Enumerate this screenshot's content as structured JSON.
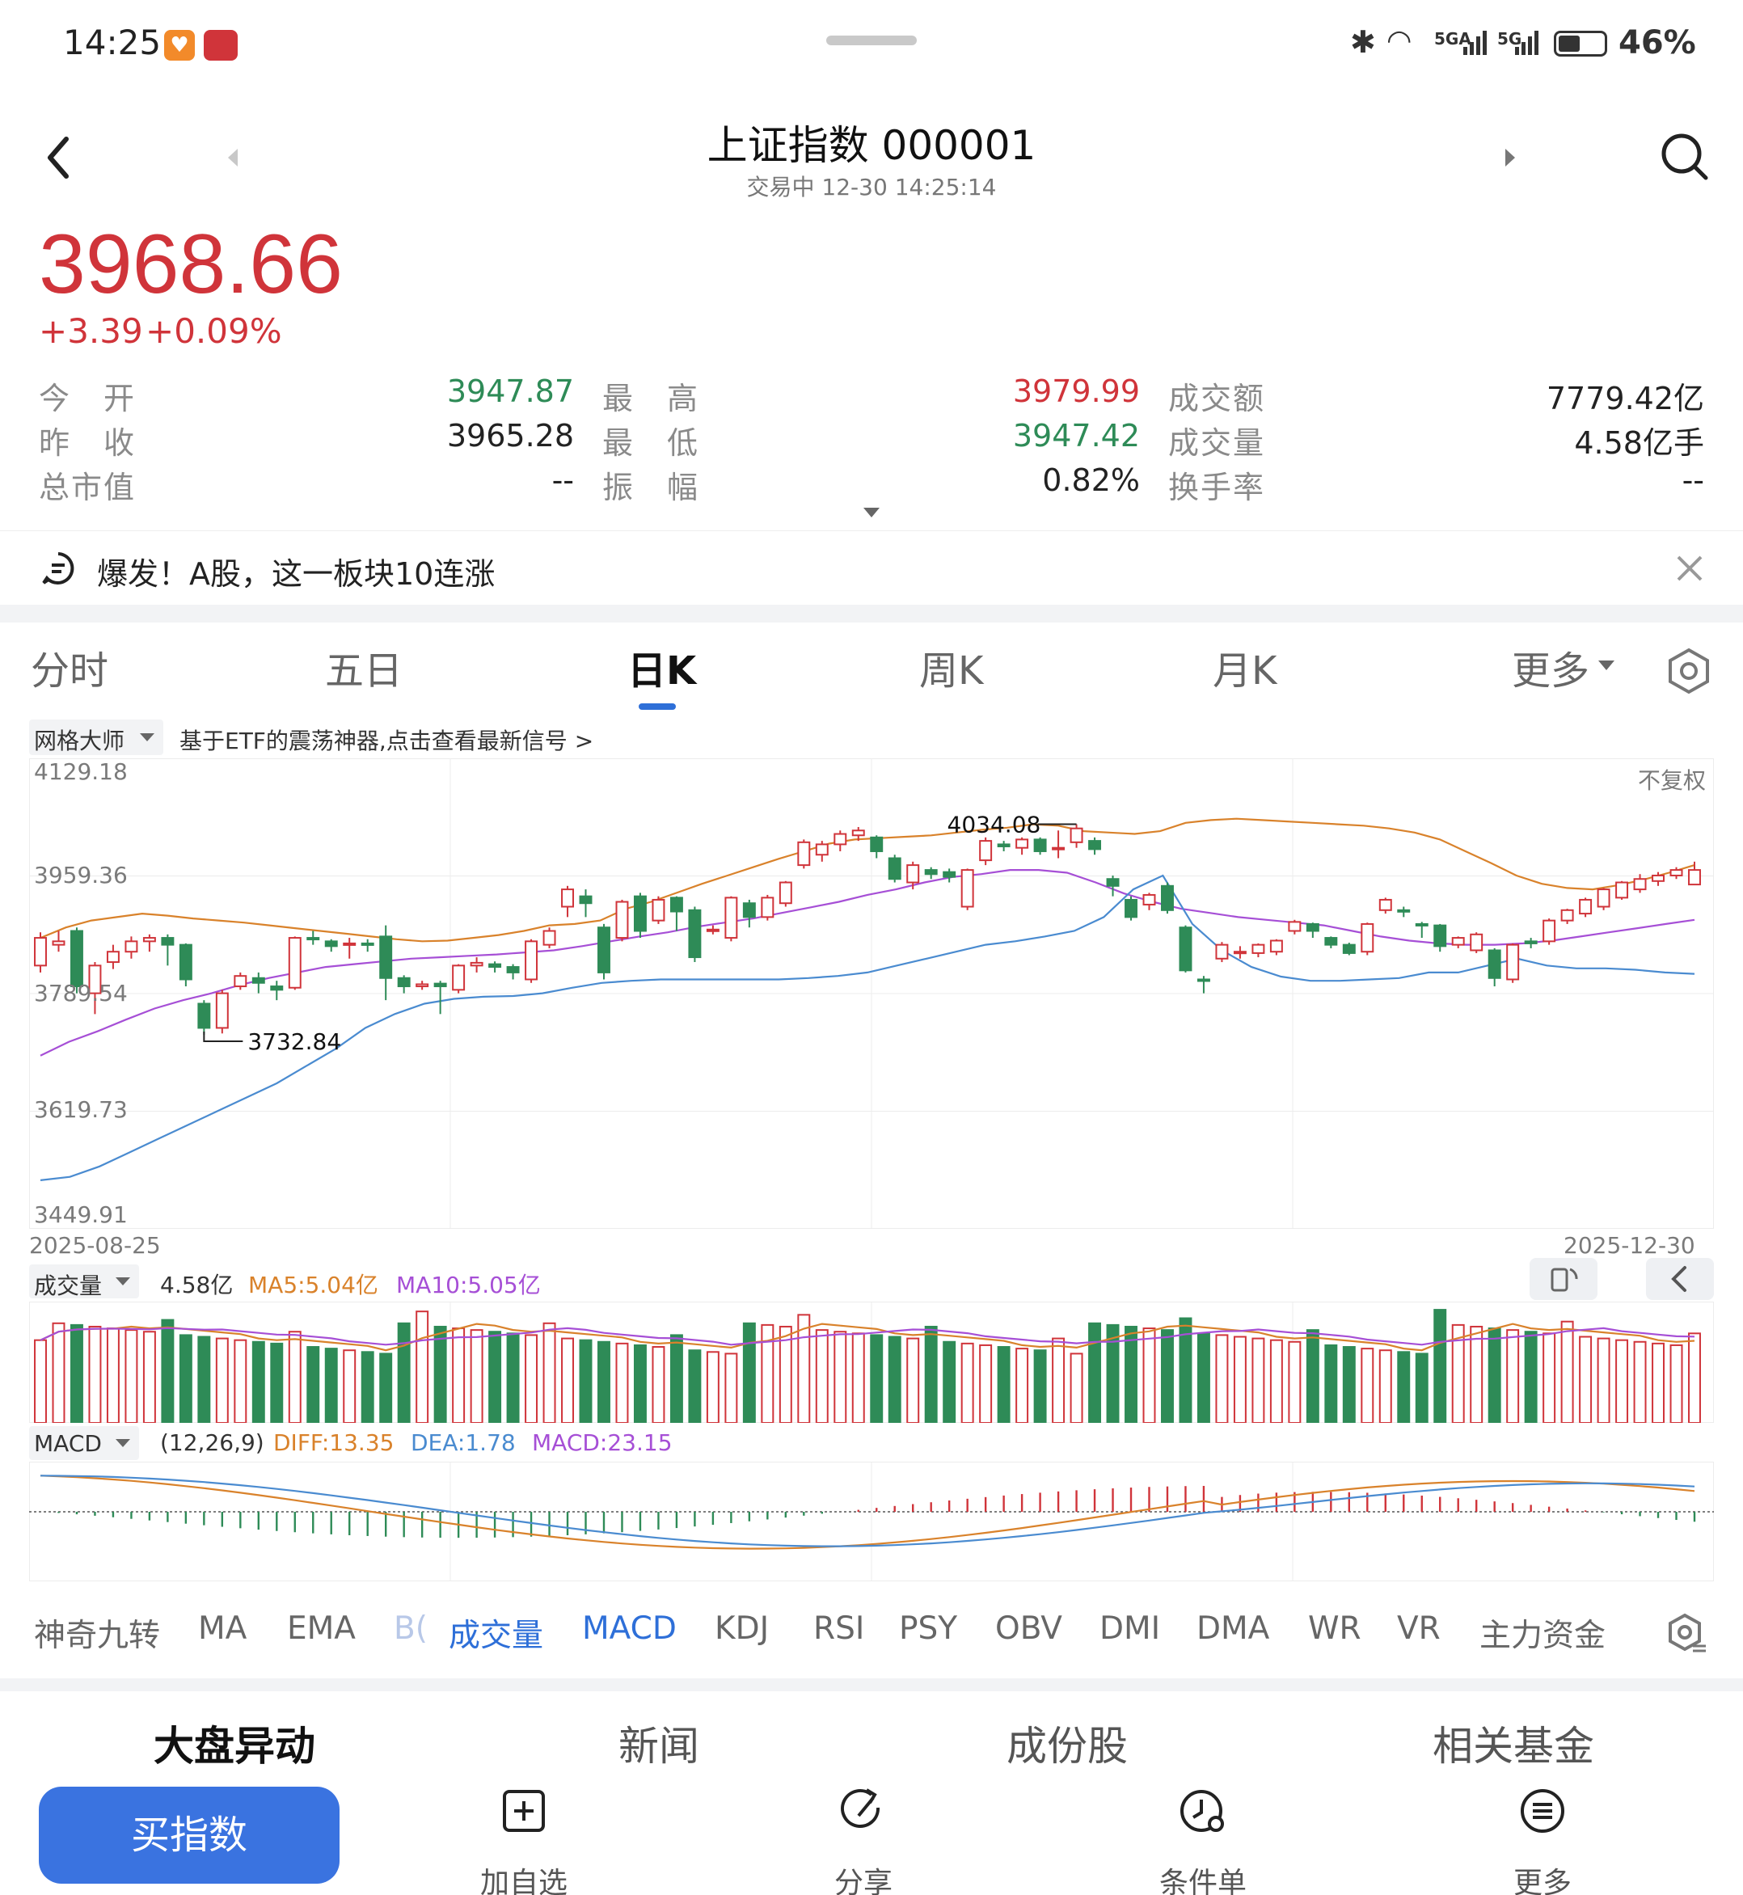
{
  "status_bar": {
    "time": "14:25",
    "battery": "46%",
    "network_1": "5GA",
    "network_2": "5G"
  },
  "header": {
    "title": "上证指数 000001",
    "subtitle": "交易中 12-30 14:25:14"
  },
  "quote": {
    "price": "3968.66",
    "change": "+3.39",
    "change_pct": "+0.09%",
    "stats": [
      {
        "label": "今　开",
        "value": "3947.87",
        "color": "green"
      },
      {
        "label": "最　高",
        "value": "3979.99",
        "color": "red"
      },
      {
        "label": "成交额",
        "value": "7779.42亿",
        "color": "black"
      },
      {
        "label": "昨　收",
        "value": "3965.28",
        "color": "black"
      },
      {
        "label": "最　低",
        "value": "3947.42",
        "color": "green"
      },
      {
        "label": "成交量",
        "value": "4.58亿手",
        "color": "black"
      },
      {
        "label": "总市值",
        "value": "--",
        "color": "black"
      },
      {
        "label": "振　幅",
        "value": "0.82%",
        "color": "black"
      },
      {
        "label": "换手率",
        "value": "--",
        "color": "black"
      }
    ]
  },
  "news_banner": {
    "text": "爆发！A股，这一板块10连涨"
  },
  "period_tabs": [
    "分时",
    "五日",
    "日K",
    "周K",
    "月K",
    "更多"
  ],
  "active_period": "日K",
  "grid_tool": {
    "name": "网格大师",
    "promo": "基于ETF的震荡神器,点击查看最新信号 >"
  },
  "chart_labels": {
    "adjust": "不复权",
    "date_start": "2025-08-25",
    "date_end": "2025-12-30",
    "high_mark": "4034.08",
    "low_mark": "3732.84"
  },
  "volume_header": {
    "name": "成交量",
    "value": "4.58亿",
    "ma5": "MA5:5.04亿",
    "ma10": "MA10:5.05亿"
  },
  "macd_header": {
    "name": "MACD",
    "params": "(12,26,9)",
    "diff": "DIFF:13.35",
    "dea": "DEA:1.78",
    "macd": "MACD:23.15"
  },
  "indicator_tabs": [
    "神奇九转",
    "MA",
    "EMA",
    "B(",
    "成交量",
    "MACD",
    "KDJ",
    "RSI",
    "PSY",
    "OBV",
    "DMI",
    "DMA",
    "WR",
    "VR",
    "主力资金"
  ],
  "bottom_tabs": [
    "大盘异动",
    "新闻",
    "成份股",
    "相关基金"
  ],
  "actions": {
    "buy": "买指数",
    "add": "加自选",
    "share": "分享",
    "condition": "条件单",
    "more": "更多"
  },
  "colors": {
    "up": "#d0343a",
    "down": "#2e8b57",
    "accent": "#2e6fd8",
    "boll_upper": "#d9822b",
    "boll_mid": "#a64fd6",
    "boll_lower": "#4a8bd0"
  },
  "chart_data": {
    "type": "candlestick",
    "y_ticks": [
      "4129.18",
      "3959.36",
      "3789.54",
      "3619.73",
      "3449.91"
    ],
    "ylim": [
      3449.91,
      4129.18
    ],
    "x_range": [
      "2025-08-25",
      "2025-12-30"
    ],
    "candles": [
      [
        3830,
        3870,
        3820,
        3878
      ],
      [
        3860,
        3865,
        3850,
        3880
      ],
      [
        3880,
        3800,
        3790,
        3885
      ],
      [
        3790,
        3830,
        3760,
        3835
      ],
      [
        3835,
        3850,
        3825,
        3860
      ],
      [
        3850,
        3865,
        3840,
        3872
      ],
      [
        3865,
        3870,
        3850,
        3875
      ],
      [
        3870,
        3860,
        3830,
        3875
      ],
      [
        3860,
        3810,
        3800,
        3862
      ],
      [
        3775,
        3740,
        3730,
        3780
      ],
      [
        3740,
        3790,
        3732,
        3795
      ],
      [
        3800,
        3815,
        3795,
        3820
      ],
      [
        3812,
        3805,
        3790,
        3820
      ],
      [
        3800,
        3795,
        3780,
        3808
      ],
      [
        3798,
        3870,
        3795,
        3872
      ],
      [
        3870,
        3868,
        3860,
        3880
      ],
      [
        3865,
        3858,
        3850,
        3868
      ],
      [
        3860,
        3862,
        3840,
        3870
      ],
      [
        3862,
        3860,
        3850,
        3868
      ],
      [
        3872,
        3812,
        3780,
        3888
      ],
      [
        3812,
        3800,
        3790,
        3816
      ],
      [
        3800,
        3803,
        3795,
        3808
      ],
      [
        3804,
        3800,
        3760,
        3808
      ],
      [
        3795,
        3830,
        3790,
        3832
      ],
      [
        3830,
        3834,
        3820,
        3842
      ],
      [
        3832,
        3828,
        3820,
        3836
      ],
      [
        3828,
        3820,
        3810,
        3832
      ],
      [
        3810,
        3865,
        3805,
        3868
      ],
      [
        3860,
        3880,
        3855,
        3885
      ],
      [
        3915,
        3940,
        3900,
        3945
      ],
      [
        3930,
        3920,
        3900,
        3940
      ],
      [
        3885,
        3820,
        3810,
        3890
      ],
      [
        3870,
        3922,
        3865,
        3925
      ],
      [
        3930,
        3880,
        3870,
        3935
      ],
      [
        3895,
        3925,
        3890,
        3930
      ],
      [
        3928,
        3908,
        3880,
        3930
      ],
      [
        3910,
        3842,
        3835,
        3915
      ],
      [
        3880,
        3882,
        3875,
        3888
      ],
      [
        3870,
        3928,
        3865,
        3930
      ],
      [
        3920,
        3900,
        3885,
        3925
      ],
      [
        3900,
        3928,
        3895,
        3932
      ],
      [
        3920,
        3950,
        3915,
        3952
      ],
      [
        3975,
        4008,
        3970,
        4012
      ],
      [
        3990,
        4005,
        3980,
        4010
      ],
      [
        4005,
        4020,
        3995,
        4025
      ],
      [
        4018,
        4025,
        4010,
        4030
      ],
      [
        4015,
        3995,
        3985,
        4018
      ],
      [
        3985,
        3955,
        3950,
        3990
      ],
      [
        3950,
        3975,
        3940,
        3980
      ],
      [
        3968,
        3962,
        3955,
        3972
      ],
      [
        3965,
        3958,
        3950,
        3970
      ],
      [
        3915,
        3968,
        3910,
        3970
      ],
      [
        3982,
        4010,
        3975,
        4015
      ],
      [
        4005,
        4002,
        3995,
        4010
      ],
      [
        4000,
        4012,
        3990,
        4015
      ],
      [
        4012,
        3995,
        3990,
        4015
      ],
      [
        3998,
        4000,
        3985,
        4025
      ],
      [
        4008,
        4028,
        4000,
        4034
      ],
      [
        4010,
        3998,
        3990,
        4015
      ],
      [
        3955,
        3945,
        3930,
        3960
      ],
      [
        3925,
        3900,
        3895,
        3930
      ],
      [
        3918,
        3932,
        3910,
        3935
      ],
      [
        3945,
        3910,
        3905,
        3950
      ],
      [
        3885,
        3823,
        3820,
        3888
      ],
      [
        3810,
        3808,
        3790,
        3815
      ],
      [
        3840,
        3860,
        3835,
        3864
      ],
      [
        3850,
        3850,
        3840,
        3858
      ],
      [
        3848,
        3860,
        3842,
        3862
      ],
      [
        3850,
        3866,
        3845,
        3868
      ],
      [
        3880,
        3893,
        3875,
        3896
      ],
      [
        3890,
        3880,
        3870,
        3892
      ],
      [
        3870,
        3860,
        3855,
        3872
      ],
      [
        3860,
        3848,
        3845,
        3863
      ],
      [
        3850,
        3890,
        3845,
        3892
      ],
      [
        3910,
        3925,
        3905,
        3928
      ],
      [
        3910,
        3908,
        3900,
        3915
      ],
      [
        3890,
        3888,
        3870,
        3893
      ],
      [
        3888,
        3858,
        3850,
        3890
      ],
      [
        3860,
        3870,
        3855,
        3872
      ],
      [
        3852,
        3875,
        3848,
        3878
      ],
      [
        3852,
        3812,
        3800,
        3855
      ],
      [
        3810,
        3860,
        3805,
        3862
      ],
      [
        3865,
        3862,
        3855,
        3870
      ],
      [
        3865,
        3895,
        3860,
        3898
      ],
      [
        3895,
        3910,
        3890,
        3912
      ],
      [
        3905,
        3925,
        3900,
        3928
      ],
      [
        3915,
        3940,
        3910,
        3942
      ],
      [
        3928,
        3950,
        3925,
        3952
      ],
      [
        3940,
        3955,
        3935,
        3962
      ],
      [
        3952,
        3960,
        3945,
        3965
      ],
      [
        3960,
        3968,
        3955,
        3972
      ],
      [
        3947,
        3968,
        3947,
        3980
      ]
    ],
    "boll_upper": [
      3870,
      3885,
      3895,
      3900,
      3905,
      3902,
      3898,
      3895,
      3892,
      3888,
      3884,
      3880,
      3876,
      3872,
      3868,
      3865,
      3866,
      3870,
      3874,
      3880,
      3888,
      3890,
      3895,
      3912,
      3922,
      3935,
      3948,
      3960,
      3972,
      3984,
      3995,
      4006,
      4012,
      4014,
      4016,
      4018,
      4022,
      4026,
      4029,
      4034,
      4032,
      4024,
      4022,
      4020,
      4024,
      4036,
      4040,
      4042,
      4040,
      4038,
      4036,
      4034,
      4032,
      4028,
      4022,
      4012,
      3995,
      3978,
      3960,
      3948,
      3942,
      3940,
      3946,
      3954,
      3964,
      3975
    ],
    "boll_mid": [
      3700,
      3720,
      3735,
      3752,
      3768,
      3780,
      3790,
      3802,
      3812,
      3820,
      3828,
      3832,
      3836,
      3840,
      3842,
      3844,
      3846,
      3849,
      3852,
      3858,
      3865,
      3872,
      3878,
      3886,
      3892,
      3898,
      3906,
      3914,
      3922,
      3932,
      3940,
      3950,
      3958,
      3962,
      3968,
      3968,
      3964,
      3950,
      3934,
      3922,
      3912,
      3906,
      3900,
      3896,
      3892,
      3888,
      3880,
      3872,
      3866,
      3862,
      3860,
      3860,
      3862,
      3866,
      3872,
      3878,
      3884,
      3890,
      3896
    ],
    "boll_lower": [
      3520,
      3525,
      3540,
      3560,
      3580,
      3600,
      3620,
      3640,
      3660,
      3685,
      3710,
      3740,
      3760,
      3775,
      3782,
      3785,
      3786,
      3790,
      3798,
      3805,
      3808,
      3810,
      3810,
      3810,
      3810,
      3810,
      3812,
      3815,
      3820,
      3830,
      3840,
      3850,
      3860,
      3865,
      3872,
      3880,
      3900,
      3940,
      3960,
      3890,
      3852,
      3828,
      3814,
      3808,
      3808,
      3810,
      3812,
      3820,
      3820,
      3830,
      3840,
      3830,
      3826,
      3826,
      3824,
      3820,
      3818
    ]
  }
}
